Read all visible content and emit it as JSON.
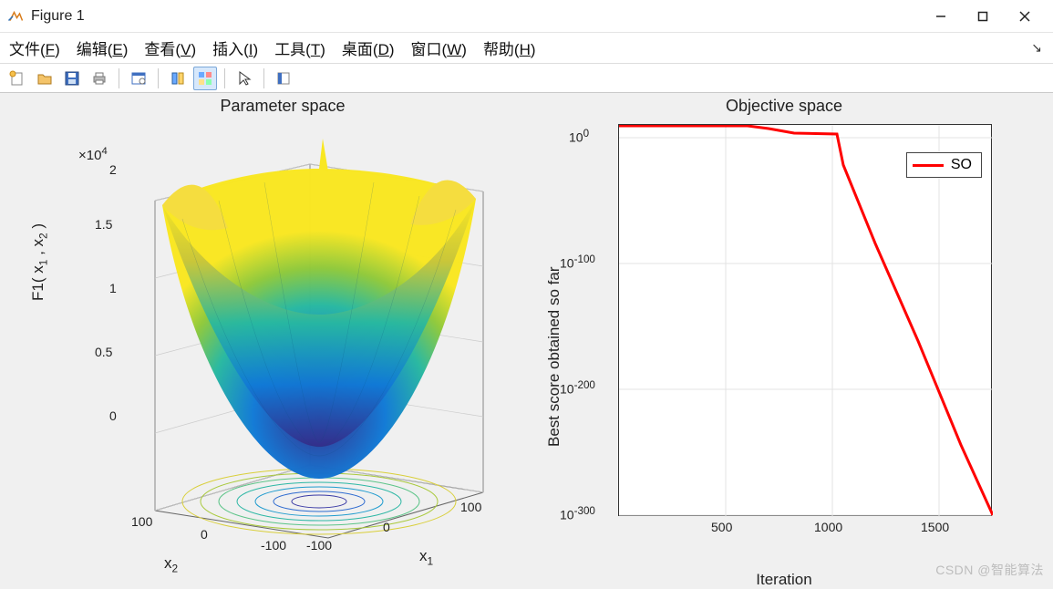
{
  "window": {
    "title": "Figure 1",
    "minimize_label": "Minimize",
    "maximize_label": "Maximize",
    "close_label": "Close"
  },
  "menu": {
    "items": [
      {
        "label": "文件(F)",
        "hotkey": "F"
      },
      {
        "label": "编辑(E)",
        "hotkey": "E"
      },
      {
        "label": "查看(V)",
        "hotkey": "V"
      },
      {
        "label": "插入(I)",
        "hotkey": "I"
      },
      {
        "label": "工具(T)",
        "hotkey": "T"
      },
      {
        "label": "桌面(D)",
        "hotkey": "D"
      },
      {
        "label": "窗口(W)",
        "hotkey": "W"
      },
      {
        "label": "帮助(H)",
        "hotkey": "H"
      }
    ],
    "dock_arrow": "↘"
  },
  "toolbar": {
    "buttons": [
      "new-figure",
      "open",
      "save",
      "print",
      "|",
      "print-preview",
      "|",
      "link-brush",
      "data-cursor",
      "|",
      "pointer",
      "|",
      "insert-colorbar"
    ],
    "active": "data-cursor"
  },
  "left_plot": {
    "title": "Parameter space",
    "zlabel": "F1( x_1 , x_2 )",
    "zlabel_html": "F1( x<sub>1</sub> , x<sub>2</sub> )",
    "xlabel": "x_1",
    "xlabel_html": "x<sub>1</sub>",
    "ylabel": "x_2",
    "ylabel_html": "x<sub>2</sub>",
    "z_multiplier": "×10^4",
    "z_ticks": [
      "0",
      "0.5",
      "1",
      "1.5",
      "2"
    ],
    "x_ticks": [
      "-100",
      "0",
      "100"
    ],
    "y_ticks": [
      "-100",
      "0",
      "100"
    ]
  },
  "right_plot": {
    "title": "Objective space",
    "xlabel": "Iteration",
    "ylabel": "Best score obtained so far",
    "x_ticks": [
      "500",
      "1000",
      "1500"
    ],
    "y_ticks_html": [
      "10<sup>-300</sup>",
      "10<sup>-200</sup>",
      "10<sup>-100</sup>",
      "10<sup>0</sup>"
    ],
    "legend": {
      "SO": "#ff0000"
    }
  },
  "watermark": "CSDN @智能算法",
  "chart_data": [
    {
      "type": "surface3d",
      "title": "Parameter space",
      "xlabel": "x_1",
      "ylabel": "x_2",
      "zlabel": "F1( x_1 , x_2 )",
      "x_range": [
        -100,
        100
      ],
      "y_range": [
        -100,
        100
      ],
      "z_range": [
        0,
        20000
      ],
      "z_multiplier_display": "×10^4",
      "function": "F1(x1,x2) = x1^2 + x2^2 (sphere-like bowl)",
      "sample_values": [
        {
          "x1": -100,
          "x2": -100,
          "F1": 20000
        },
        {
          "x1": -100,
          "x2": 0,
          "F1": 10000
        },
        {
          "x1": -100,
          "x2": 100,
          "F1": 20000
        },
        {
          "x1": 0,
          "x2": -100,
          "F1": 10000
        },
        {
          "x1": 0,
          "x2": 0,
          "F1": 0
        },
        {
          "x1": 0,
          "x2": 100,
          "F1": 10000
        },
        {
          "x1": 100,
          "x2": -100,
          "F1": 20000
        },
        {
          "x1": 100,
          "x2": 0,
          "F1": 10000
        },
        {
          "x1": 100,
          "x2": 100,
          "F1": 20000
        }
      ],
      "colormap": "parula",
      "has_floor_contour": true
    },
    {
      "type": "line",
      "title": "Objective space",
      "xlabel": "Iteration",
      "ylabel": "Best score obtained so far",
      "yscale": "log",
      "xlim": [
        0,
        1750
      ],
      "ylim": [
        1e-300,
        10
      ],
      "x_ticks": [
        500,
        1000,
        1500
      ],
      "y_ticks": [
        1e-300,
        1e-200,
        1e-100,
        1
      ],
      "series": [
        {
          "name": "SO",
          "color": "#ff0000",
          "x": [
            0,
            200,
            600,
            700,
            820,
            1020,
            1050,
            1200,
            1400,
            1600,
            1750
          ],
          "y_log10": [
            0.6,
            0.5,
            0.5,
            -2,
            -5,
            -6,
            -30,
            -90,
            -165,
            -245,
            -300
          ]
        }
      ],
      "legend_position": "upper right",
      "grid": true
    }
  ]
}
